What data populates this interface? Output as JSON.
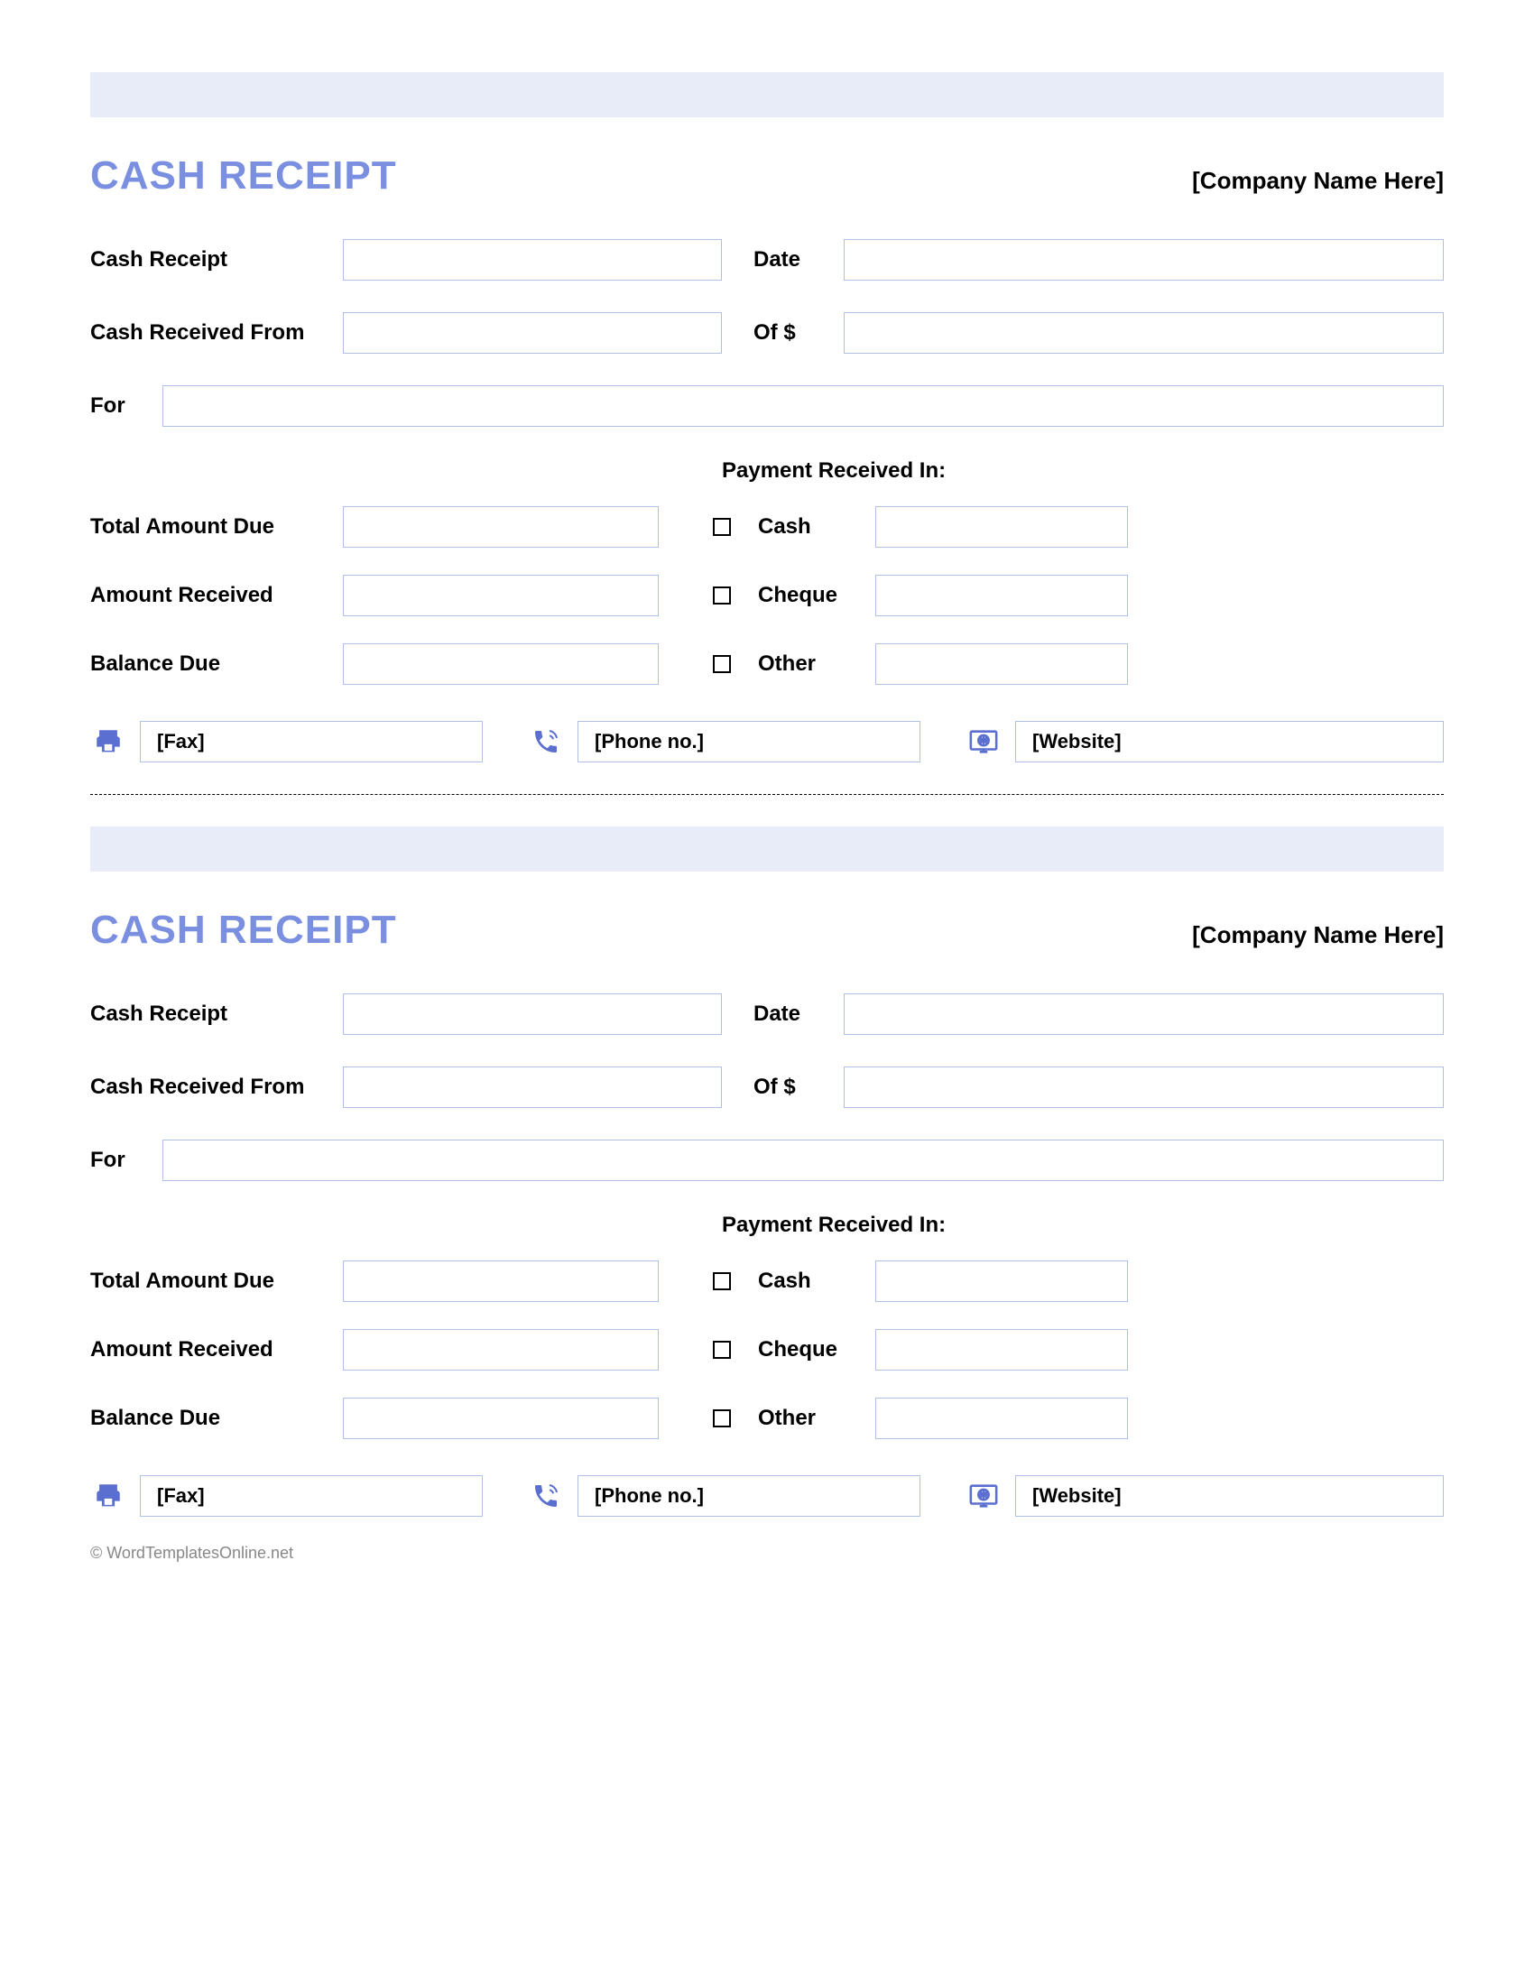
{
  "receipts": [
    {
      "title": "CASH RECEIPT",
      "company": "[Company Name Here]",
      "labels": {
        "receipt": "Cash Receipt",
        "date": "Date",
        "from": "Cash Received From",
        "of": "Of $",
        "for": "For",
        "payment": "Payment Received In:",
        "total": "Total Amount Due",
        "amount": "Amount Received",
        "balance": "Balance Due",
        "cash": "Cash",
        "cheque": "Cheque",
        "other": "Other"
      },
      "contacts": {
        "fax": "[Fax]",
        "phone": "[Phone no.]",
        "website": "[Website]"
      }
    },
    {
      "title": "CASH RECEIPT",
      "company": "[Company Name Here]",
      "labels": {
        "receipt": "Cash Receipt",
        "date": "Date",
        "from": "Cash Received From",
        "of": "Of $",
        "for": "For",
        "payment": "Payment Received In:",
        "total": "Total Amount Due",
        "amount": "Amount Received",
        "balance": "Balance Due",
        "cash": "Cash",
        "cheque": "Cheque",
        "other": "Other"
      },
      "contacts": {
        "fax": "[Fax]",
        "phone": "[Phone no.]",
        "website": "[Website]"
      }
    }
  ],
  "footer": "© WordTemplatesOnline.net"
}
